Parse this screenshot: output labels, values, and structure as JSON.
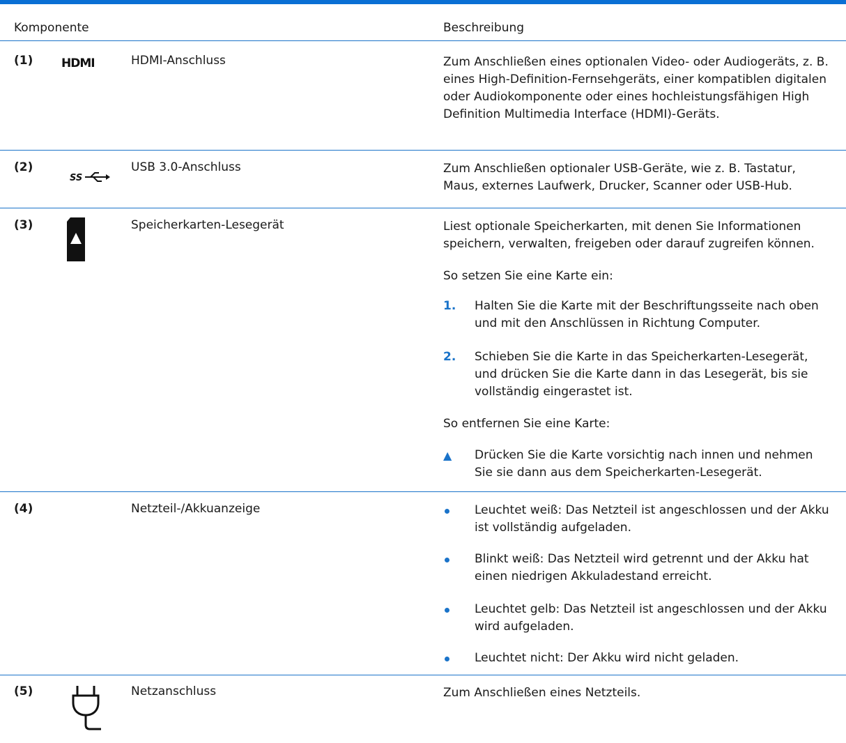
{
  "header": {
    "col_component": "Komponente",
    "col_description": "Beschreibung"
  },
  "rows": [
    {
      "num": "(1)",
      "icon": "hdmi-icon",
      "icon_text": "HDMI",
      "name": "HDMI-Anschluss",
      "description": "Zum Anschließen eines optionalen Video- oder Audiogeräts, z. B. eines High-Definition-Fernsehgeräts, einer kompatiblen digitalen oder Audiokomponente oder eines hochleistungsfähigen High Definition Multimedia Interface (HDMI)-Geräts."
    },
    {
      "num": "(2)",
      "icon": "usb-superspeed-icon",
      "icon_text": "SS",
      "name": "USB 3.0-Anschluss",
      "description": "Zum Anschließen optionaler USB-Geräte, wie z. B. Tastatur, Maus, externes Laufwerk, Drucker, Scanner oder USB-Hub."
    },
    {
      "num": "(3)",
      "icon": "memory-card-icon",
      "name": "Speicherkarten-Lesegerät",
      "description": "Liest optionale Speicherkarten, mit denen Sie Informationen speichern, verwalten, freigeben oder darauf zugreifen können.",
      "insert_heading": "So setzen Sie eine Karte ein:",
      "steps": [
        {
          "marker": "1.",
          "text": "Halten Sie die Karte mit der Beschriftungsseite nach oben und mit den Anschlüssen in Richtung Computer."
        },
        {
          "marker": "2.",
          "text": "Schieben Sie die Karte in das Speicherkarten-Lesegerät, und drücken Sie die Karte dann in das Lesegerät, bis sie vollständig eingerastet ist."
        }
      ],
      "remove_heading": "So entfernen Sie eine Karte:",
      "remove_step": {
        "marker": "▲",
        "text": "Drücken Sie die Karte vorsichtig nach innen und nehmen Sie sie dann aus dem Speicherkarten-Lesegerät."
      }
    },
    {
      "num": "(4)",
      "name": "Netzteil-/Akkuanzeige",
      "bullets": [
        "Leuchtet weiß: Das Netzteil ist angeschlossen und der Akku ist vollständig aufgeladen.",
        "Blinkt weiß: Das Netzteil wird getrennt und der Akku hat einen niedrigen Akkuladestand erreicht.",
        "Leuchtet gelb: Das Netzteil ist angeschlossen und der Akku wird aufgeladen.",
        "Leuchtet nicht: Der Akku wird nicht geladen."
      ]
    },
    {
      "num": "(5)",
      "icon": "power-plug-icon",
      "name": "Netzanschluss",
      "description": "Zum Anschließen eines Netzteils."
    }
  ],
  "colors": {
    "accent": "#1a73c9",
    "topbar": "#0a6fd4"
  }
}
